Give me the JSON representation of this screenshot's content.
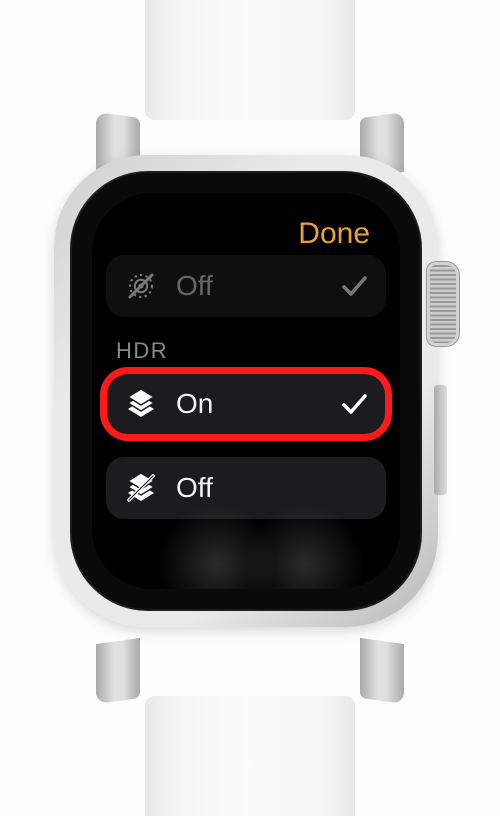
{
  "header": {
    "done_label": "Done"
  },
  "livephoto_row": {
    "label": "Off",
    "selected": true
  },
  "hdr_section": {
    "title": "HDR"
  },
  "hdr_on": {
    "label": "On",
    "selected": true
  },
  "hdr_off": {
    "label": "Off",
    "selected": false
  },
  "colors": {
    "accent": "#e8a23a",
    "highlight": "#ff1a1a"
  }
}
